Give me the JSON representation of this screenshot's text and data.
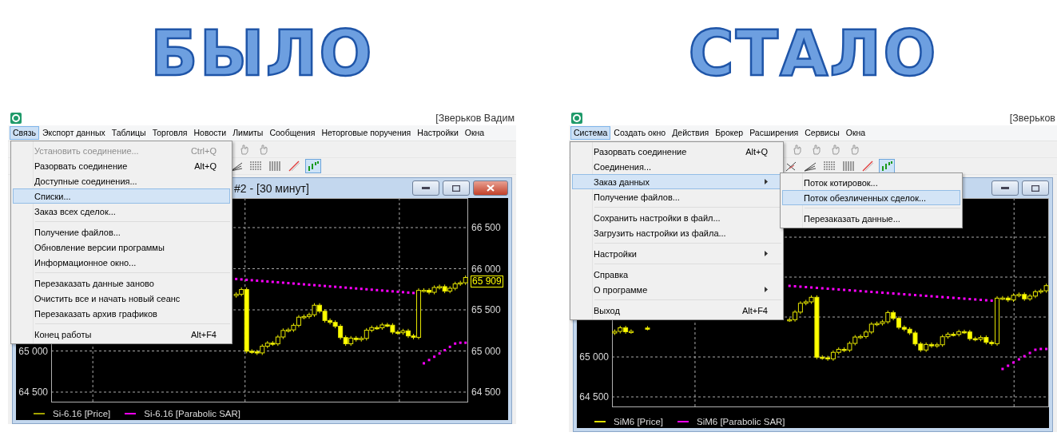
{
  "panels": [
    {
      "heading": "БЫЛО",
      "user": "[Зверьков Вадим",
      "menu_bar": [
        {
          "label": "Связь",
          "selected": true
        },
        {
          "label": "Экспорт данных",
          "selected": false
        },
        {
          "label": "Таблицы",
          "selected": false
        },
        {
          "label": "Торговля",
          "selected": false
        },
        {
          "label": "Новости",
          "selected": false
        },
        {
          "label": "Лимиты",
          "selected": false
        },
        {
          "label": "Сообщения",
          "selected": false
        },
        {
          "label": "Неторговые поручения",
          "selected": false
        },
        {
          "label": "Настройки",
          "selected": false
        },
        {
          "label": "Окна",
          "selected": false
        }
      ],
      "toolbars": [
        [
          {
            "kind": "hand",
            "pressed": false
          },
          {
            "kind": "hand",
            "pressed": false
          }
        ],
        [
          {
            "kind": "angle",
            "pressed": false
          },
          {
            "kind": "hlines",
            "pressed": false
          },
          {
            "kind": "vlines",
            "pressed": false
          },
          {
            "kind": "diagonal",
            "pressed": false
          },
          {
            "kind": "bars",
            "pressed": true
          }
        ]
      ],
      "dropdown": [
        {
          "kind": "item",
          "label": "Установить соединение...",
          "shortcut": "Ctrl+Q",
          "disabled": true,
          "selected": false,
          "submenu": false
        },
        {
          "kind": "item",
          "label": "Разорвать соединение",
          "shortcut": "Alt+Q",
          "disabled": false,
          "selected": false,
          "submenu": false
        },
        {
          "kind": "item",
          "label": "Доступные соединения...",
          "disabled": false,
          "selected": false,
          "submenu": false
        },
        {
          "kind": "item",
          "label": "Списки...",
          "disabled": false,
          "selected": true,
          "submenu": false
        },
        {
          "kind": "item",
          "label": "Заказ всех сделок...",
          "disabled": false,
          "selected": false,
          "submenu": false
        },
        {
          "kind": "separator"
        },
        {
          "kind": "item",
          "label": "Получение файлов...",
          "disabled": false,
          "selected": false,
          "submenu": false
        },
        {
          "kind": "item",
          "label": "Обновление версии программы",
          "disabled": false,
          "selected": false,
          "submenu": false
        },
        {
          "kind": "item",
          "label": "Информационное окно...",
          "disabled": false,
          "selected": false,
          "submenu": false
        },
        {
          "kind": "separator"
        },
        {
          "kind": "item",
          "label": "Перезаказать данные заново",
          "disabled": false,
          "selected": false,
          "submenu": false
        },
        {
          "kind": "item",
          "label": "Очистить все и начать новый сеанс",
          "disabled": false,
          "selected": false,
          "submenu": false
        },
        {
          "kind": "item",
          "label": "Перезаказать архив графиков",
          "disabled": false,
          "selected": false,
          "submenu": false
        },
        {
          "kind": "separator"
        },
        {
          "kind": "item",
          "label": "Конец работы",
          "shortcut": "Alt+F4",
          "disabled": false,
          "selected": false,
          "submenu": false
        }
      ],
      "chart_window": {
        "title": "#2 - [30 минут]",
        "buttons": [
          {
            "kind": "minimize"
          },
          {
            "kind": "maximize"
          },
          {
            "kind": "close"
          }
        ],
        "left_axis": [
          "65 000",
          "64 500"
        ],
        "right_axis": [
          "66 500",
          "66 000",
          "65 500",
          "65 000",
          "64 500"
        ],
        "price_label": "65 909",
        "legend": [
          {
            "label": "Si-6.16 [Price]",
            "color": "#a3a300"
          },
          {
            "label": "Si-6.16 [Parabolic SAR]",
            "color": "#ff00ff"
          }
        ]
      }
    },
    {
      "heading": "СТАЛО",
      "user": "[Зверьков",
      "menu_bar": [
        {
          "label": "Система",
          "selected": true
        },
        {
          "label": "Создать окно",
          "selected": false
        },
        {
          "label": "Действия",
          "selected": false
        },
        {
          "label": "Брокер",
          "selected": false
        },
        {
          "label": "Расширения",
          "selected": false
        },
        {
          "label": "Сервисы",
          "selected": false
        },
        {
          "label": "Окна",
          "selected": false
        }
      ],
      "toolbars": [
        [
          {
            "kind": "hand",
            "pressed": false
          },
          {
            "kind": "hand",
            "pressed": false
          },
          {
            "kind": "hand",
            "pressed": false
          },
          {
            "kind": "hand",
            "pressed": false
          }
        ],
        [
          {
            "kind": "cross",
            "pressed": false
          },
          {
            "kind": "angle",
            "pressed": false
          },
          {
            "kind": "hlines",
            "pressed": false
          },
          {
            "kind": "vlines",
            "pressed": false
          },
          {
            "kind": "diagonal",
            "pressed": false
          },
          {
            "kind": "bars",
            "pressed": true
          }
        ]
      ],
      "dropdown": [
        {
          "kind": "item",
          "label": "Разорвать соединение",
          "shortcut": "Alt+Q",
          "disabled": false,
          "selected": false,
          "submenu": false
        },
        {
          "kind": "item",
          "label": "Соединения...",
          "disabled": false,
          "selected": false,
          "submenu": false
        },
        {
          "kind": "item",
          "label": "Заказ данных",
          "disabled": false,
          "selected": true,
          "submenu": true
        },
        {
          "kind": "item",
          "label": "Получение файлов...",
          "disabled": false,
          "selected": false,
          "submenu": false
        },
        {
          "kind": "separator"
        },
        {
          "kind": "item",
          "label": "Сохранить настройки в файл...",
          "disabled": false,
          "selected": false,
          "submenu": false
        },
        {
          "kind": "item",
          "label": "Загрузить настройки из файла...",
          "disabled": false,
          "selected": false,
          "submenu": false
        },
        {
          "kind": "separator"
        },
        {
          "kind": "item",
          "label": "Настройки",
          "disabled": false,
          "selected": false,
          "submenu": true
        },
        {
          "kind": "separator"
        },
        {
          "kind": "item",
          "label": "Справка",
          "disabled": false,
          "selected": false,
          "submenu": false
        },
        {
          "kind": "item",
          "label": "О программе",
          "disabled": false,
          "selected": false,
          "submenu": true
        },
        {
          "kind": "separator"
        },
        {
          "kind": "item",
          "label": "Выход",
          "shortcut": "Alt+F4",
          "disabled": false,
          "selected": false,
          "submenu": false
        }
      ],
      "submenu": [
        {
          "kind": "item",
          "label": "Поток котировок...",
          "disabled": false,
          "selected": false,
          "submenu": false
        },
        {
          "kind": "item",
          "label": "Поток обезличенных сделок...",
          "disabled": false,
          "selected": true,
          "submenu": false
        },
        {
          "kind": "separator"
        },
        {
          "kind": "item",
          "label": "Перезаказать данные...",
          "disabled": false,
          "selected": false,
          "submenu": false
        }
      ],
      "chart_window": {
        "buttons": [
          {
            "kind": "minimize"
          },
          {
            "kind": "maximize"
          }
        ],
        "left_axis": [
          "65 000",
          "64 500"
        ],
        "legend": [
          {
            "label": "SiM6 [Price]",
            "color": "#e0e000"
          },
          {
            "label": "SiM6 [Parabolic SAR]",
            "color": "#ff00ff"
          }
        ]
      }
    }
  ]
}
